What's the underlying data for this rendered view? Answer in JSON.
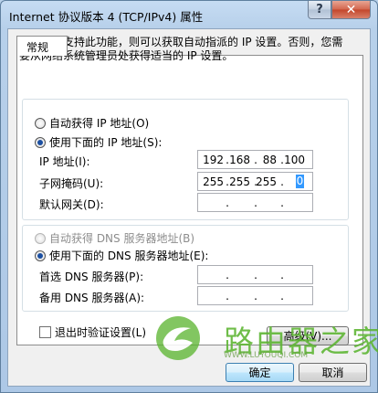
{
  "window": {
    "title": "Internet 协议版本 4 (TCP/IPv4) 属性",
    "help_glyph": "?",
    "close_glyph": "✕"
  },
  "tab": {
    "label": "常规"
  },
  "description": "如果网络支持此功能，则可以获取自动指派的 IP 设置。否则，您需要从网络系统管理员处获得适当的 IP 设置。",
  "ip_section": {
    "auto_label": "自动获得 IP 地址(O)",
    "manual_label": "使用下面的 IP 地址(S):",
    "ip_label": "IP 地址(I):",
    "mask_label": "子网掩码(U):",
    "gateway_label": "默认网关(D):",
    "ip": [
      "192",
      "168",
      "88",
      "100"
    ],
    "mask": [
      "255",
      "255",
      "255",
      "0"
    ],
    "gateway": [
      "",
      "",
      "",
      ""
    ]
  },
  "dns_section": {
    "auto_label": "自动获得 DNS 服务器地址(B)",
    "manual_label": "使用下面的 DNS 服务器地址(E):",
    "preferred_label": "首选 DNS 服务器(P):",
    "alternate_label": "备用 DNS 服务器(A):",
    "preferred": [
      "",
      "",
      "",
      ""
    ],
    "alternate": [
      "",
      "",
      "",
      ""
    ]
  },
  "validate_label": "退出时验证设置(L)",
  "advanced_label": "高级(V)...",
  "ok_label": "确定",
  "cancel_label": "取消",
  "watermark": {
    "text": "路由器之家",
    "sub": "WWW.LUYOUQI.COM"
  },
  "colors": {
    "radio_dot": "#1b4fa1",
    "selection": "#3399ff",
    "watermark": "#5cb531"
  }
}
